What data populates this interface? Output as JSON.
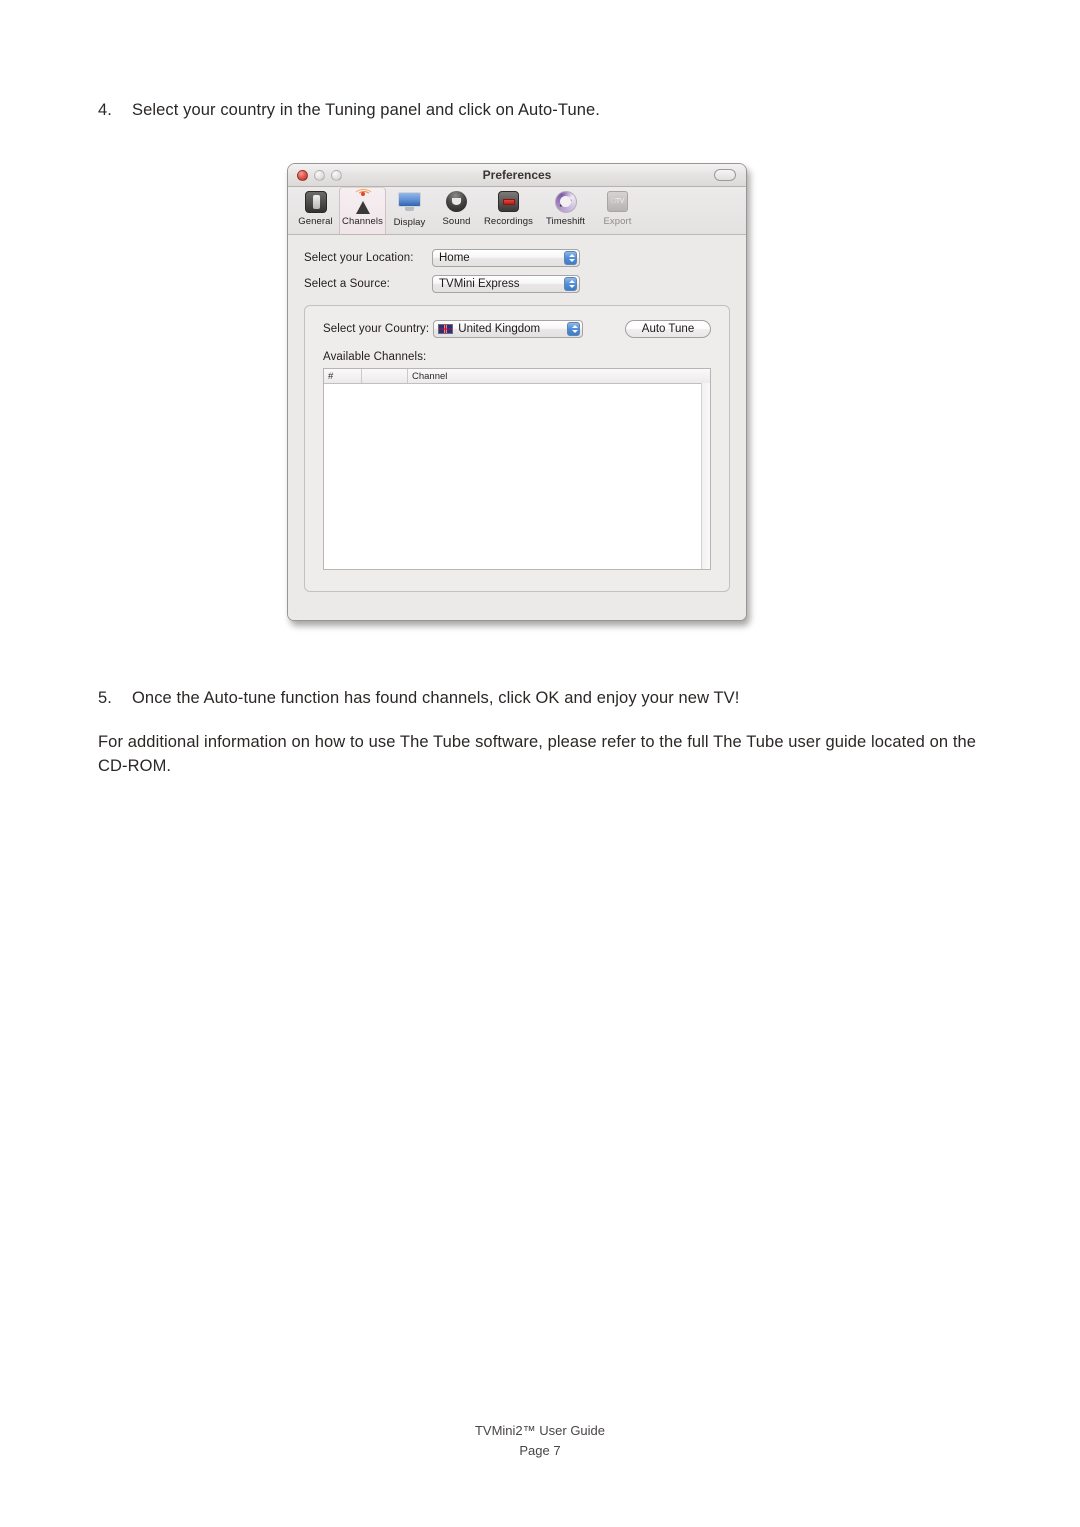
{
  "document": {
    "step4": {
      "number": "4.",
      "text": "Select your country in the Tuning panel and click on Auto-Tune."
    },
    "step5": {
      "number": "5.",
      "text": "Once the Auto-tune function has found channels, click OK and enjoy your new TV!"
    },
    "paragraph": "For additional information on how to use The Tube software, please refer to the full The Tube user guide located on the CD-ROM.",
    "footer": {
      "line1": "TVMini2™ User Guide",
      "line2": "Page 7"
    }
  },
  "window": {
    "title": "Preferences",
    "traffic": {
      "close": "close-button",
      "minimize": "minimize-button",
      "zoom": "zoom-button"
    },
    "toolbar_toggle": "toolbar-toggle-button",
    "toolbar": {
      "items": [
        {
          "label": "General",
          "icon": "general-icon",
          "selected": false,
          "enabled": true
        },
        {
          "label": "Channels",
          "icon": "antenna-icon",
          "selected": true,
          "enabled": true
        },
        {
          "label": "Display",
          "icon": "monitor-icon",
          "selected": false,
          "enabled": true
        },
        {
          "label": "Sound",
          "icon": "speaker-icon",
          "selected": false,
          "enabled": true
        },
        {
          "label": "Recordings",
          "icon": "record-icon",
          "selected": false,
          "enabled": true
        },
        {
          "label": "Timeshift",
          "icon": "dial-icon",
          "selected": false,
          "enabled": true
        },
        {
          "label": "Export",
          "icon": "appletv-icon",
          "selected": false,
          "enabled": false
        }
      ]
    },
    "pane": {
      "location": {
        "label": "Select your Location:",
        "value": "Home"
      },
      "source": {
        "label": "Select a Source:",
        "value": "TVMini Express"
      },
      "country": {
        "label": "Select your Country:",
        "value": "United Kingdom",
        "flag": "uk-flag-icon"
      },
      "auto_tune_button": "Auto Tune",
      "available_label": "Available Channels:",
      "channels_table": {
        "columns": [
          "#",
          "",
          "Channel"
        ],
        "rows": []
      }
    }
  },
  "colors": {
    "window_bg": "#ece9e9",
    "title_text": "#3b3636",
    "close_red": "#e2584c",
    "stepper_blue": "#4f8ed6",
    "selected_tab": "#f0e6ea",
    "body_text": "#2b2725"
  }
}
